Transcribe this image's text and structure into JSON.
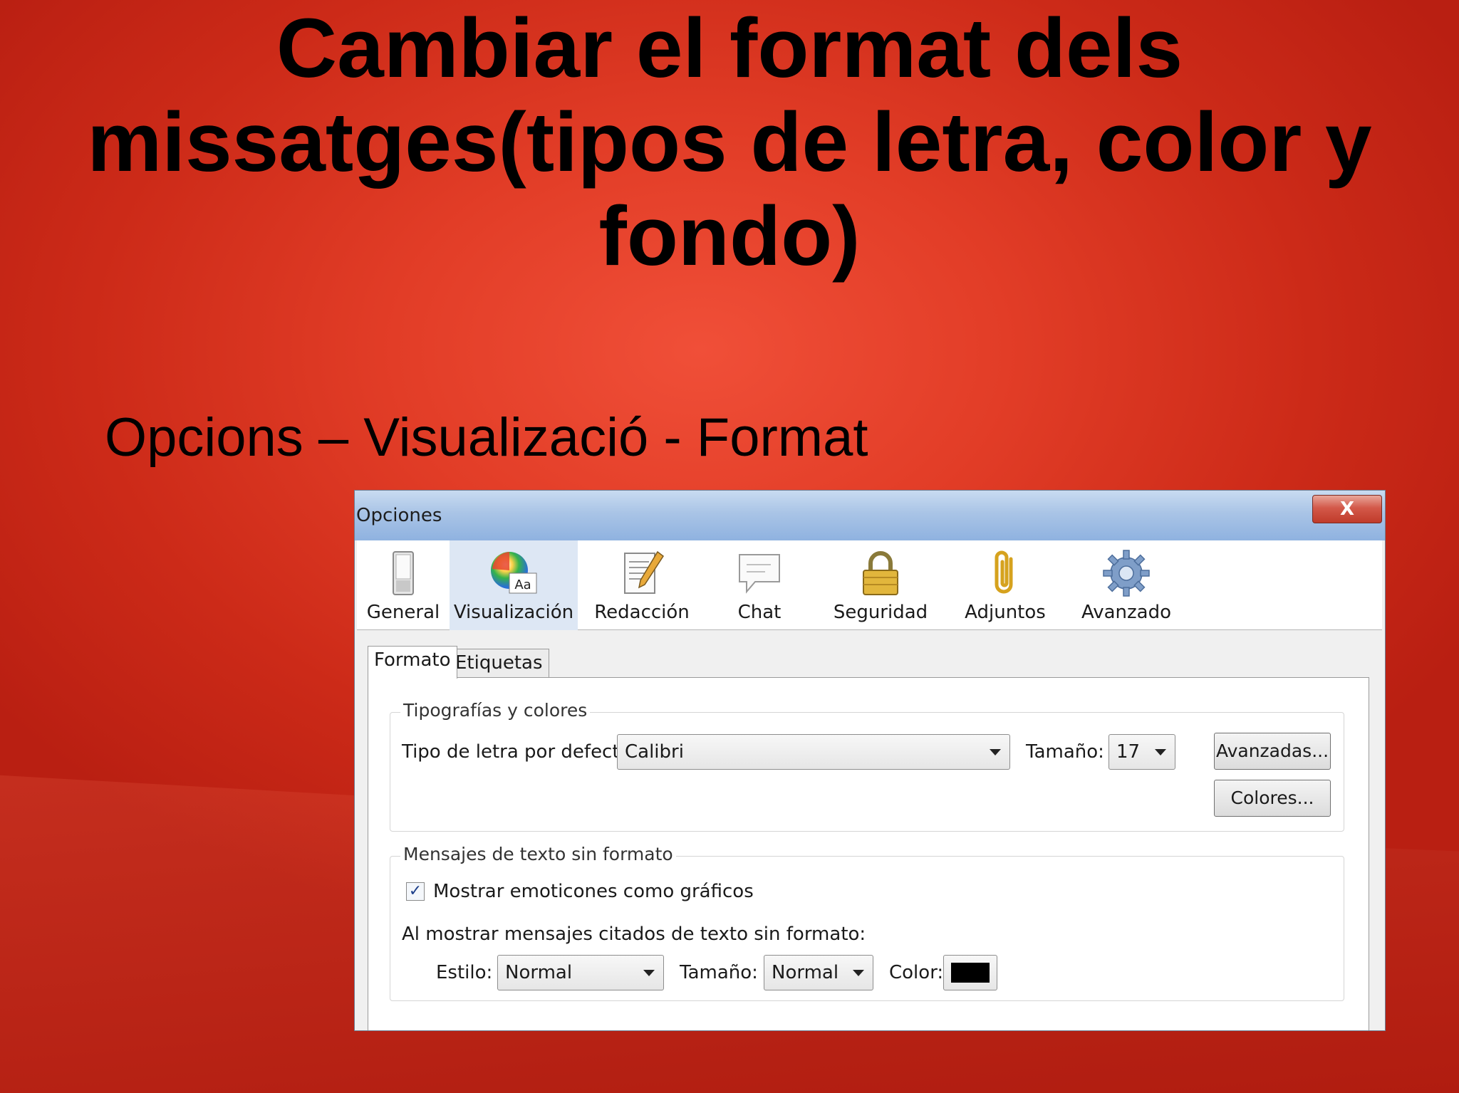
{
  "slide": {
    "title": "Cambiar el format dels missatges(tipos de letra, color y fondo)",
    "subtitle": "Opcions – Visualizació - Format"
  },
  "dialog": {
    "title": "Opciones",
    "close_label": "X",
    "toolbar": [
      {
        "label": "General",
        "icon": "switch-icon"
      },
      {
        "label": "Visualización",
        "icon": "color-wheel-icon",
        "selected": true
      },
      {
        "label": "Redacción",
        "icon": "pencil-document-icon"
      },
      {
        "label": "Chat",
        "icon": "speech-bubble-icon"
      },
      {
        "label": "Seguridad",
        "icon": "padlock-icon"
      },
      {
        "label": "Adjuntos",
        "icon": "paperclip-icon"
      },
      {
        "label": "Avanzado",
        "icon": "gear-icon"
      }
    ],
    "tabs": [
      {
        "label": "Formato",
        "active": true
      },
      {
        "label": "Etiquetas",
        "active": false
      }
    ],
    "fonts_group": {
      "legend": "Tipografías y colores",
      "default_font_label": "Tipo de letra por defecto:",
      "default_font_value": "Calibri",
      "size_label": "Tamaño:",
      "size_value": "17",
      "advanced_button": "Avanzadas...",
      "colors_button": "Colores..."
    },
    "plain_group": {
      "legend": "Mensajes de texto sin formato",
      "emoticons_label": "Mostrar emoticones como gráficos",
      "emoticons_checked": true,
      "quoted_label": "Al mostrar mensajes citados de texto sin formato:",
      "style_label": "Estilo:",
      "style_value": "Normal",
      "size_label": "Tamaño:",
      "size_value": "Normal",
      "color_label": "Color:",
      "color_value": "#000000"
    }
  }
}
